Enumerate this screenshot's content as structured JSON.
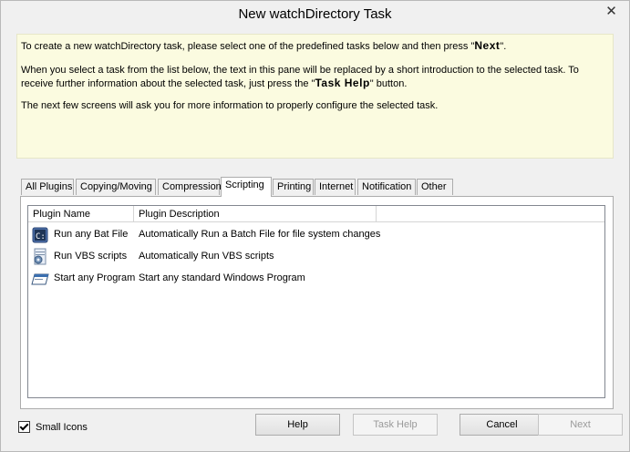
{
  "window": {
    "title": "New watchDirectory Task",
    "close_label": "✕"
  },
  "info": {
    "p1_pre": "To create a new watchDirectory task, please select one of the predefined tasks below and then press \"",
    "p1_key": "Next",
    "p1_post": "\".",
    "p2_pre": "When you select a task from the list below, the text in this pane will be replaced by a short introduction to the selected task. To receive further information about the selected task, just press the \"",
    "p2_key": "Task Help",
    "p2_post": "\" button.",
    "p3": "The next few screens will ask you for more information to properly configure the selected task."
  },
  "tabs": [
    {
      "label": "All Plugins"
    },
    {
      "label": "Copying/Moving"
    },
    {
      "label": "Compression"
    },
    {
      "label": "Scripting"
    },
    {
      "label": "Printing"
    },
    {
      "label": "Internet"
    },
    {
      "label": "Notification"
    },
    {
      "label": "Other"
    }
  ],
  "active_tab": "Scripting",
  "list": {
    "columns": [
      "Plugin Name",
      "Plugin Description"
    ],
    "rows": [
      {
        "name": "Run any Bat File",
        "description": "Automatically Run a Batch File for file system changes",
        "icon": "batch-file-icon"
      },
      {
        "name": "Run VBS scripts",
        "description": "Automatically Run VBS scripts",
        "icon": "vbs-script-icon"
      },
      {
        "name": "Start any Program",
        "description": "Start any standard Windows Program",
        "icon": "program-window-icon"
      }
    ]
  },
  "footer": {
    "small_icons_label": "Small Icons",
    "small_icons_checked": true,
    "help_label": "Help",
    "task_help_label": "Task Help",
    "cancel_label": "Cancel",
    "next_label": "Next"
  }
}
